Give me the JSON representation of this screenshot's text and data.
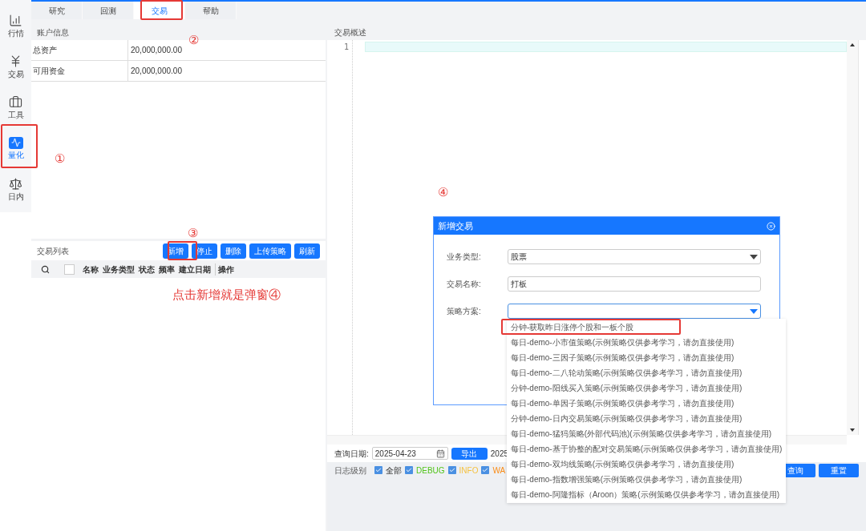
{
  "sidebar": {
    "items": [
      {
        "label": "行情",
        "kind": "chart",
        "selected": false
      },
      {
        "label": "交易",
        "kind": "yen",
        "selected": false
      },
      {
        "label": "工具",
        "kind": "briefcase",
        "selected": false
      },
      {
        "label": "量化",
        "kind": "pulse",
        "selected": true
      },
      {
        "label": "日内",
        "kind": "scale",
        "selected": false
      }
    ]
  },
  "tabs": [
    {
      "label": "研究",
      "selected": false
    },
    {
      "label": "回测",
      "selected": false
    },
    {
      "label": "交易",
      "selected": true
    },
    {
      "label": "帮助",
      "selected": false
    }
  ],
  "account_panel": {
    "title": "账户信息",
    "rows": [
      {
        "label": "总资产",
        "value": "20,000,000.00"
      },
      {
        "label": "可用资金",
        "value": "20,000,000.00"
      }
    ]
  },
  "trade_list": {
    "title": "交易列表",
    "select_all_checked": false,
    "buttons": [
      "新增",
      "停止",
      "删除",
      "上传策略",
      "刷新"
    ],
    "columns": [
      "名称",
      "业务类型",
      "状态",
      "频率",
      "建立日期",
      "操作"
    ]
  },
  "overview_panel": {
    "title": "交易概述",
    "line_numbers": [
      "1"
    ]
  },
  "query_bar": {
    "date_label": "查询日期:",
    "date_value": "2025-04-23",
    "export_button": "导出",
    "date_value_2": "2025",
    "log_label": "日志级别",
    "levels": [
      {
        "label": "全部",
        "checked": true
      },
      {
        "label": "DEBUG",
        "checked": true,
        "color": "#52c41a"
      },
      {
        "label": "INFO",
        "checked": true,
        "color": "#f5c242"
      },
      {
        "label": "WA",
        "checked": true,
        "color": "#fa8c16"
      }
    ],
    "buttons": [
      "查询",
      "重置"
    ]
  },
  "dialog": {
    "title": "新增交易",
    "fields": [
      {
        "label": "业务类型:",
        "kind": "select",
        "value": "股票",
        "open": false
      },
      {
        "label": "交易名称:",
        "kind": "input",
        "value": "打板"
      },
      {
        "label": "策略方案:",
        "kind": "select",
        "open": true
      }
    ]
  },
  "dropdown_options": [
    "分钟-获取昨日涨停个股和一板个股",
    "每日-demo-小市值策略(示例策略仅供参考学习，请勿直接使用)",
    "每日-demo-三因子策略(示例策略仅供参考学习，请勿直接使用)",
    "每日-demo-二八轮动策略(示例策略仅供参考学习，请勿直接使用)",
    "分钟-demo-阳线买入策略(示例策略仅供参考学习，请勿直接使用)",
    "每日-demo-单因子策略(示例策略仅供参考学习，请勿直接使用)",
    "分钟-demo-日内交易策略(示例策略仅供参考学习，请勿直接使用)",
    "每日-demo-猛犸策略(外部代码池)(示例策略仅供参考学习，请勿直接使用)",
    "每日-demo-基于协整的配对交易策略(示例策略仅供参考学习，请勿直接使用)",
    "每日-demo-双均线策略(示例策略仅供参考学习，请勿直接使用)",
    "每日-demo-指数增强策略(示例策略仅供参考学习，请勿直接使用)",
    "每日-demo-阿隆指标（Aroon）策略(示例策略仅供参考学习，请勿直接使用)"
  ],
  "annotations": {
    "markers": [
      "①",
      "②",
      "③",
      "④"
    ],
    "note": "点击新增就是弹窗④"
  }
}
